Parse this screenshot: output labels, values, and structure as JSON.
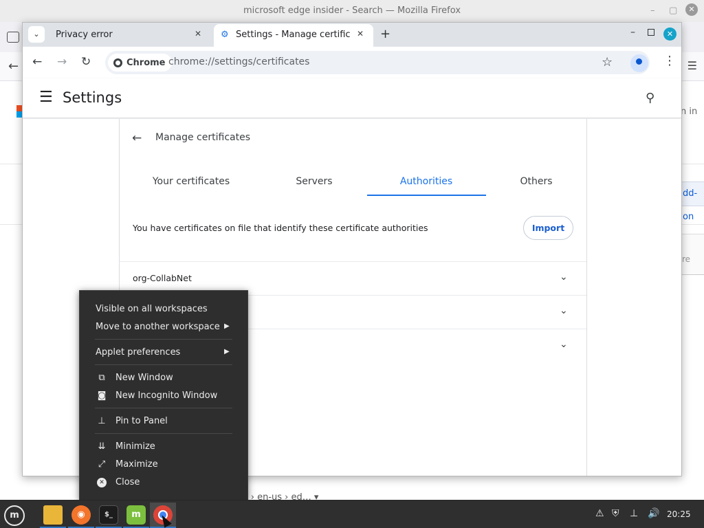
{
  "firefox": {
    "title": "microsoft edge insider - Search — Mozilla Firefox",
    "sign_in_partial": "n in",
    "addon_partial": "dd-on",
    "more_partial": "re",
    "breadcrumb_partial": "om › en-us › ed…  ▾"
  },
  "chrome": {
    "tabs": [
      {
        "title": "Privacy error"
      },
      {
        "title": "Settings - Manage certificate"
      }
    ],
    "omnibox": {
      "chip_label": "Chrome",
      "url": "chrome://settings/certificates"
    }
  },
  "settings": {
    "title": "Settings",
    "page_title": "Manage certificates",
    "tabs": [
      "Your certificates",
      "Servers",
      "Authorities",
      "Others"
    ],
    "active_tab": "Authorities",
    "info_text": "You have certificates on file that identify these certificate authorities",
    "import_label": "Import",
    "certificates": [
      "org-CollabNet",
      "",
      ""
    ]
  },
  "context_menu": {
    "items": [
      {
        "label": "Visible on all workspaces",
        "icon": ""
      },
      {
        "label": "Move to another workspace",
        "icon": "",
        "submenu": true
      },
      {
        "label": "Applet preferences",
        "icon": "",
        "submenu": true
      },
      {
        "label": "New Window",
        "icon": "new-window-icon"
      },
      {
        "label": "New Incognito Window",
        "icon": "incognito-icon"
      },
      {
        "label": "Pin to Panel",
        "icon": "pin-icon"
      },
      {
        "label": "Minimize",
        "icon": "minimize-icon"
      },
      {
        "label": "Maximize",
        "icon": "maximize-icon"
      },
      {
        "label": "Close",
        "icon": "close-icon"
      }
    ]
  },
  "taskbar": {
    "apps": [
      "files",
      "firefox",
      "terminal",
      "linux-mint",
      "chrome"
    ],
    "clock": "20:25"
  },
  "colors": {
    "accent": "#1a73e8",
    "menu_bg": "#2e2e2e",
    "taskbar_bg": "#2f2f2f",
    "window_close": "#15a3c9"
  }
}
